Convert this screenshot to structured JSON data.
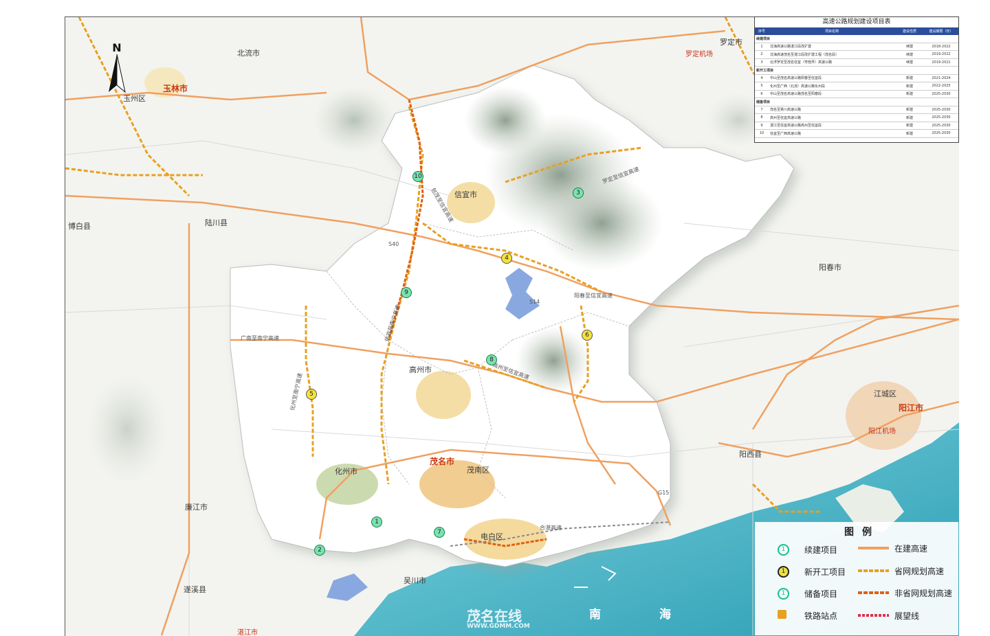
{
  "map": {
    "north_label": "N",
    "cities": {
      "yulin": "玉林市",
      "yuzhou": "玉州区",
      "beiliu": "北流市",
      "luoding": "罗定市",
      "luoding_airport": "罗定机场",
      "bobai": "博白县",
      "luchuan": "陆川县",
      "xinyi": "信宜市",
      "gaozhou": "高州市",
      "huazhou": "化州市",
      "maoming": "茂名市",
      "maonan": "茂南区",
      "dianbai": "电白区",
      "lianjiang": "廉江市",
      "suixi": "遂溪县",
      "zhanjiang": "湛江市",
      "yangchun": "阳春市",
      "yangjiang": "阳江市",
      "jiangcheng": "江城区",
      "yangxi": "阳西县",
      "yangjiang_airport": "阳江机场",
      "zhaner": "吴川市"
    },
    "roads": {
      "s40": "S40",
      "s540": "S40",
      "s514": "S14",
      "g15": "G15",
      "luoxin": "罗定至信宜高速",
      "yangxin": "阳春至信宜高速",
      "hezhan": "合湛高速",
      "guangnan": "广南至南宁高速",
      "maoyang": "包茂至信宜高速",
      "hua_nan": "化州至南宁高速",
      "gaoxin": "高州至信宜高速",
      "xinnan": "信宜至南宁高速"
    },
    "sea_labels": [
      "南",
      "海"
    ],
    "markers": [
      {
        "n": "1",
        "kind": "green"
      },
      {
        "n": "2",
        "kind": "green"
      },
      {
        "n": "3",
        "kind": "green"
      },
      {
        "n": "4",
        "kind": "yellow"
      },
      {
        "n": "5",
        "kind": "yellow"
      },
      {
        "n": "6",
        "kind": "yellow"
      },
      {
        "n": "7",
        "kind": "green"
      },
      {
        "n": "8",
        "kind": "green"
      },
      {
        "n": "9",
        "kind": "green"
      },
      {
        "n": "10",
        "kind": "green"
      }
    ],
    "watermark": {
      "brand": "茂名在线",
      "url": "WWW.GDMM.COM"
    }
  },
  "table": {
    "title": "高速公路规划建设项目表",
    "headers": [
      "序号",
      "项目名称",
      "建设性质",
      "建设期限（年）"
    ],
    "groups": [
      {
        "label": "续建项目",
        "rows": [
          {
            "no": "1",
            "name": "沈海高速公路湛江段改扩建",
            "type": "续建",
            "period": "2018-2022"
          },
          {
            "no": "2",
            "name": "沈海高速茂名至湛江段改扩建工程（茂名段）",
            "type": "续建",
            "period": "2019-2022"
          },
          {
            "no": "3",
            "name": "云浮罗定至茂名信宜（粤桂界）高速公路",
            "type": "续建",
            "period": "2019-2021"
          }
        ]
      },
      {
        "label": "新开工项目",
        "rows": [
          {
            "no": "4",
            "name": "中山至茂名高速公路阳春至信宜段",
            "type": "新建",
            "period": "2021-2024"
          },
          {
            "no": "5",
            "name": "化州至广西（北流）高速公路化州段",
            "type": "新建",
            "period": "2022-2025"
          },
          {
            "no": "6",
            "name": "中山至茂名高速公路茂名至阳春段",
            "type": "新建",
            "period": "2025-2030"
          }
        ]
      },
      {
        "label": "储备项目",
        "rows": [
          {
            "no": "7",
            "name": "茂名至吴川高速公路",
            "type": "新建",
            "period": "2025-2030"
          },
          {
            "no": "8",
            "name": "高州至信宜高速公路",
            "type": "新建",
            "period": "2025-2030"
          },
          {
            "no": "9",
            "name": "湛江至信宜高速公路高州至信宜段",
            "type": "新建",
            "period": "2025-2030"
          },
          {
            "no": "10",
            "name": "信宜至广西高速公路",
            "type": "新建",
            "period": "2025-2030"
          }
        ]
      }
    ]
  },
  "legend": {
    "title": "图例",
    "items": [
      {
        "sym": "1",
        "label": "续建项目",
        "color": "#16c08a"
      },
      {
        "sym": "1",
        "label": "新开工项目",
        "color": "#f0e040"
      },
      {
        "sym": "1",
        "label": "储备项目",
        "color": "#16c08a"
      },
      {
        "sym": "",
        "label": "铁路站点",
        "color": "#e8a020"
      }
    ],
    "lines": [
      {
        "label": "在建高速",
        "color": "#f0a060"
      },
      {
        "label": "省网规划高速",
        "color": "#e8a020"
      },
      {
        "label": "非省网规划高速",
        "color": "#e06010"
      },
      {
        "label": "展望线",
        "color": "#e03050"
      }
    ]
  }
}
